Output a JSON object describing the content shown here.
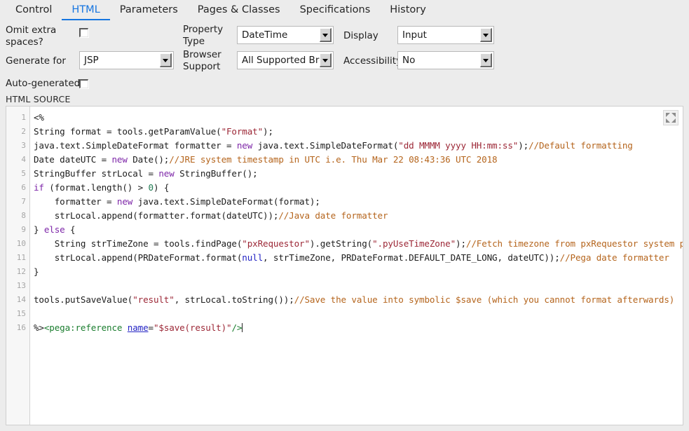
{
  "tabs": [
    {
      "label": "Control",
      "active": false
    },
    {
      "label": "HTML",
      "active": true
    },
    {
      "label": "Parameters",
      "active": false
    },
    {
      "label": "Pages & Classes",
      "active": false
    },
    {
      "label": "Specifications",
      "active": false
    },
    {
      "label": "History",
      "active": false
    }
  ],
  "form": {
    "omit_extra_spaces_label": "Omit extra spaces?",
    "omit_extra_spaces_value": "unchecked",
    "generate_for_label": "Generate for",
    "generate_for_value": "JSP",
    "auto_generated_label": "Auto-generated?",
    "auto_generated_value": "unchecked",
    "property_type_label": "Property Type",
    "property_type_value": "DateTime",
    "browser_support_label": "Browser Support",
    "browser_support_value": "All Supported Brow",
    "display_label": "Display",
    "display_value": "Input",
    "accessibility_label": "Accessibility",
    "accessibility_value": "No"
  },
  "source": {
    "section_label": "HTML SOURCE",
    "expand_icon": "expand-arrows-icon",
    "line_numbers": [
      1,
      2,
      3,
      4,
      5,
      6,
      7,
      8,
      9,
      10,
      11,
      12,
      13,
      14,
      15,
      16
    ],
    "lines": [
      {
        "n": 1,
        "tokens": [
          {
            "t": "<%",
            "c": ""
          }
        ]
      },
      {
        "n": 2,
        "tokens": [
          {
            "t": "String format = tools.getParamValue(",
            "c": ""
          },
          {
            "t": "\"Format\"",
            "c": "t-str"
          },
          {
            "t": ");",
            "c": ""
          }
        ]
      },
      {
        "n": 3,
        "tokens": [
          {
            "t": "java.text.SimpleDateFormat formatter = ",
            "c": ""
          },
          {
            "t": "new",
            "c": "t-kw"
          },
          {
            "t": " java.text.SimpleDateFormat(",
            "c": ""
          },
          {
            "t": "\"dd MMMM yyyy HH:mm:ss\"",
            "c": "t-str"
          },
          {
            "t": ");",
            "c": ""
          },
          {
            "t": "//Default formatting",
            "c": "t-cmt"
          }
        ]
      },
      {
        "n": 4,
        "tokens": [
          {
            "t": "Date dateUTC = ",
            "c": ""
          },
          {
            "t": "new",
            "c": "t-kw"
          },
          {
            "t": " Date();",
            "c": ""
          },
          {
            "t": "//JRE system timestamp in UTC i.e. Thu Mar 22 08:43:36 UTC 2018",
            "c": "t-cmt"
          }
        ]
      },
      {
        "n": 5,
        "tokens": [
          {
            "t": "StringBuffer strLocal = ",
            "c": ""
          },
          {
            "t": "new",
            "c": "t-kw"
          },
          {
            "t": " StringBuffer();",
            "c": ""
          }
        ]
      },
      {
        "n": 6,
        "tokens": [
          {
            "t": "if",
            "c": "t-kw"
          },
          {
            "t": " (format.length() > ",
            "c": ""
          },
          {
            "t": "0",
            "c": "t-num"
          },
          {
            "t": ") {",
            "c": ""
          }
        ]
      },
      {
        "n": 7,
        "tokens": [
          {
            "t": "    formatter = ",
            "c": ""
          },
          {
            "t": "new",
            "c": "t-kw"
          },
          {
            "t": " java.text.SimpleDateFormat(format);",
            "c": ""
          }
        ]
      },
      {
        "n": 8,
        "tokens": [
          {
            "t": "    strLocal.append(formatter.format(dateUTC));",
            "c": ""
          },
          {
            "t": "//Java date formatter",
            "c": "t-cmt"
          }
        ]
      },
      {
        "n": 9,
        "tokens": [
          {
            "t": "} ",
            "c": ""
          },
          {
            "t": "else",
            "c": "t-kw"
          },
          {
            "t": " {",
            "c": ""
          }
        ]
      },
      {
        "n": 10,
        "tokens": [
          {
            "t": "    String strTimeZone = tools.findPage(",
            "c": ""
          },
          {
            "t": "\"pxRequestor\"",
            "c": "t-str"
          },
          {
            "t": ").getString(",
            "c": ""
          },
          {
            "t": "\".pyUseTimeZone\"",
            "c": "t-str"
          },
          {
            "t": ");",
            "c": ""
          },
          {
            "t": "//Fetch timezone from pxRequestor system page",
            "c": "t-cmt"
          }
        ]
      },
      {
        "n": 11,
        "tokens": [
          {
            "t": "    strLocal.append(PRDateFormat.format(",
            "c": ""
          },
          {
            "t": "null",
            "c": "t-null"
          },
          {
            "t": ", strTimeZone, PRDateFormat.DEFAULT_DATE_LONG, dateUTC));",
            "c": ""
          },
          {
            "t": "//Pega date formatter",
            "c": "t-cmt"
          }
        ]
      },
      {
        "n": 12,
        "tokens": [
          {
            "t": "}",
            "c": ""
          }
        ]
      },
      {
        "n": 13,
        "tokens": [
          {
            "t": "",
            "c": ""
          }
        ]
      },
      {
        "n": 14,
        "tokens": [
          {
            "t": "tools.putSaveValue(",
            "c": ""
          },
          {
            "t": "\"result\"",
            "c": "t-str"
          },
          {
            "t": ", strLocal.toString());",
            "c": ""
          },
          {
            "t": "//Save the value into symbolic $save (which you cannot format afterwards)",
            "c": "t-cmt"
          }
        ]
      },
      {
        "n": 15,
        "tokens": [
          {
            "t": "",
            "c": ""
          }
        ]
      },
      {
        "n": 16,
        "tokens": [
          {
            "t": "%>",
            "c": ""
          },
          {
            "t": "<pega:reference",
            "c": "t-tag"
          },
          {
            "t": " ",
            "c": ""
          },
          {
            "t": "name",
            "c": "t-attr"
          },
          {
            "t": "=",
            "c": ""
          },
          {
            "t": "\"$save(result)\"",
            "c": "t-str"
          },
          {
            "t": "/>",
            "c": "t-tag"
          },
          {
            "t": "|CARET|",
            "c": "caret"
          }
        ]
      }
    ]
  },
  "colors": {
    "accent": "#1675e0",
    "panel_bg": "#ececec",
    "editor_bg": "#ffffff",
    "gutter_bg": "#f7f7f7",
    "string": "#9c2736",
    "comment": "#b5651d",
    "keyword": "#7d26a8",
    "number": "#1f7a52",
    "null_literal": "#2424c4",
    "tag": "#1a7d2e"
  }
}
